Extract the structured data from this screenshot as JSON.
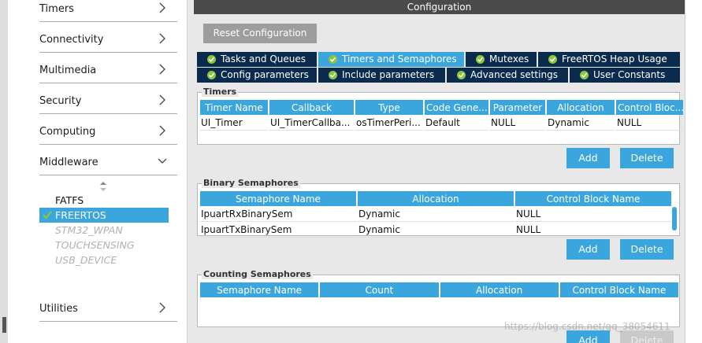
{
  "sidebar": {
    "categories": [
      {
        "label": "Timers"
      },
      {
        "label": "Connectivity"
      },
      {
        "label": "Multimedia"
      },
      {
        "label": "Security"
      },
      {
        "label": "Computing"
      },
      {
        "label": "Middleware"
      }
    ],
    "middleware_items": [
      {
        "label": "FATFS",
        "state": "normal"
      },
      {
        "label": "FREERTOS",
        "state": "selected"
      },
      {
        "label": "STM32_WPAN",
        "state": "disabled"
      },
      {
        "label": "TOUCHSENSING",
        "state": "disabled"
      },
      {
        "label": "USB_DEVICE",
        "state": "disabled"
      }
    ],
    "utilities": {
      "label": "Utilities"
    }
  },
  "config": {
    "title": "Configuration",
    "reset_label": "Reset Configuration",
    "tabs_row1": [
      {
        "label": "Tasks and Queues",
        "active": false
      },
      {
        "label": "Timers and Semaphores",
        "active": true
      },
      {
        "label": "Mutexes",
        "active": false
      },
      {
        "label": "FreeRTOS Heap Usage",
        "active": false
      }
    ],
    "tabs_row2": [
      {
        "label": "Config parameters",
        "active": false
      },
      {
        "label": "Include parameters",
        "active": false
      },
      {
        "label": "Advanced settings",
        "active": false
      },
      {
        "label": "User Constants",
        "active": false
      }
    ],
    "timers": {
      "title": "Timers",
      "columns": [
        "Timer Name",
        "Callback",
        "Type",
        "Code Gene...",
        "Parameter",
        "Allocation",
        "Control Bloc..."
      ],
      "rows": [
        [
          "UI_Timer",
          "UI_TimerCallba...",
          "osTimerPeri...",
          "Default",
          "NULL",
          "Dynamic",
          "NULL"
        ]
      ],
      "add_label": "Add",
      "delete_label": "Delete"
    },
    "binary_semaphores": {
      "title": "Binary Semaphores",
      "columns": [
        "Semaphore Name",
        "Allocation",
        "Control Block Name"
      ],
      "rows": [
        [
          "IpuartRxBinarySem",
          "Dynamic",
          "NULL"
        ],
        [
          "IpuartTxBinarySem",
          "Dynamic",
          "NULL"
        ]
      ],
      "add_label": "Add",
      "delete_label": "Delete"
    },
    "counting_semaphores": {
      "title": "Counting Semaphores",
      "columns": [
        "Semaphore Name",
        "Count",
        "Allocation",
        "Control Block Name"
      ],
      "rows": [],
      "add_label": "Add",
      "delete_label": "Delete"
    }
  },
  "watermark": "https://blog.csdn.net/qq_38054611",
  "colors": {
    "accent": "#3ba5dd",
    "tab_dark": "#0a2a4e",
    "header": "#4a4a4a",
    "check_green": "#8cc63f"
  }
}
